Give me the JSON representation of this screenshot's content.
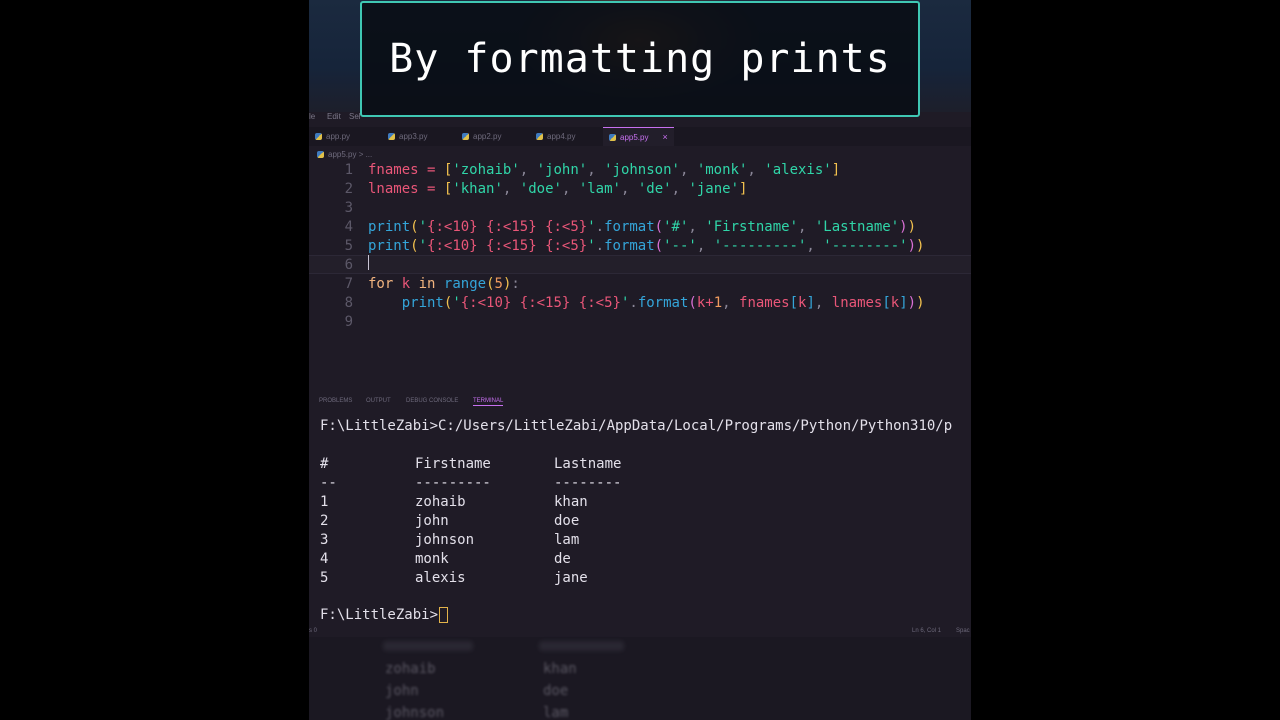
{
  "title_banner": "By formatting prints",
  "menu": [
    "le",
    "Edit",
    "Sel"
  ],
  "tabs": [
    {
      "label": "app.py",
      "active": false
    },
    {
      "label": "app3.py",
      "active": false
    },
    {
      "label": "app2.py",
      "active": false
    },
    {
      "label": "app4.py",
      "active": false
    },
    {
      "label": "app5.py",
      "active": true
    }
  ],
  "tab_close_glyph": "×",
  "breadcrumb": "app5.py > ...",
  "editor": {
    "line_numbers": [
      "1",
      "2",
      "3",
      "4",
      "5",
      "6",
      "7",
      "8",
      "9"
    ],
    "current_line": "6"
  },
  "panel_tabs": [
    "PROBLEMS",
    "OUTPUT",
    "DEBUG CONSOLE",
    "TERMINAL"
  ],
  "panel_active_tab": "TERMINAL",
  "terminal": {
    "command_line": "F:\\LittleZabi>C:/Users/LittleZabi/AppData/Local/Programs/Python/Python310/p",
    "header": [
      "#",
      "Firstname",
      "Lastname"
    ],
    "separator": [
      "--",
      "---------",
      "--------"
    ],
    "rows": [
      [
        "1",
        "zohaib",
        "khan"
      ],
      [
        "2",
        "john",
        "doe"
      ],
      [
        "3",
        "johnson",
        "lam"
      ],
      [
        "4",
        "monk",
        "de"
      ],
      [
        "5",
        "alexis",
        "jane"
      ]
    ],
    "prompt": "F:\\LittleZabi>"
  },
  "statusbar": {
    "left": "s 0",
    "position": "Ln 6, Col 1",
    "spaces": "Spac"
  },
  "ghost": {
    "rows": [
      [
        "zohaib",
        "khan"
      ],
      [
        "john",
        "doe"
      ],
      [
        "johnson",
        "lam"
      ]
    ]
  },
  "colors": {
    "accent": "#c770f0",
    "banner_border": "#3fc7b3",
    "background": "#1f1b26"
  }
}
